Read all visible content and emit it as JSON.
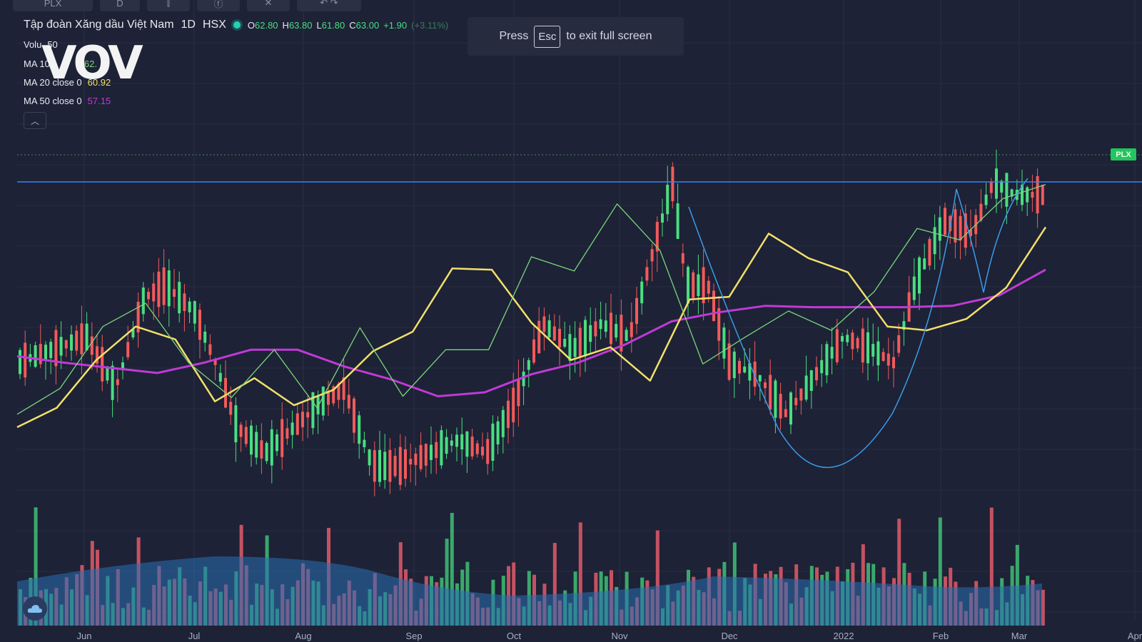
{
  "toolbar": {
    "symbol": "PLX",
    "interval_btn": "D"
  },
  "legend": {
    "name": "Tập đoàn Xăng dầu Việt Nam",
    "interval": "1D",
    "exchange": "HSX",
    "ohlc": {
      "o_key": "O",
      "o_val": "62.80",
      "h_key": "H",
      "h_val": "63.80",
      "l_key": "L",
      "l_val": "61.80",
      "c_key": "C",
      "c_val": "63.00",
      "change": "+1.90",
      "change_pct": "(+3.11%)"
    },
    "volume_label": "Volu",
    "volume_val": "50",
    "ma10_label": "MA 10",
    "ma10_val": "62.",
    "ma20_label": "MA 20 close 0",
    "ma20_val": "60.92",
    "ma50_label": "MA 50 close 0",
    "ma50_val": "57.15"
  },
  "fullscreen": {
    "press": "Press",
    "key": "Esc",
    "rest": "to exit full screen"
  },
  "watermark": "VOV",
  "price_tag": "PLX",
  "colors": {
    "background": "#1d2236",
    "up": "#4ade80",
    "down": "#f25a5a",
    "ma10": "#7bd67b",
    "ma20": "#f2e06a",
    "ma50": "#c03ad6",
    "ma_blue": "#3b9be8",
    "hline": "#3b82f6",
    "volume_area": "#2a6fb5"
  },
  "chart_data": {
    "type": "line",
    "x_labels": [
      "Jun",
      "Jul",
      "Aug",
      "Sep",
      "Oct",
      "Nov",
      "Dec",
      "2022",
      "Feb",
      "Mar",
      "Apr"
    ],
    "series": [
      {
        "name": "MA 20 close 0",
        "values": [
          45.0,
          46.5,
          50.2,
          52.8,
          51.8,
          47.0,
          48.8,
          46.7,
          47.9,
          50.9,
          52.4,
          57.3,
          57.2,
          53.1,
          50.2,
          51.2,
          48.6,
          54.9,
          55.1,
          60.0,
          58.1,
          57.0,
          52.8,
          52.5,
          53.4,
          55.8,
          60.5
        ]
      },
      {
        "name": "MA 50 close 0",
        "values": [
          50.5,
          50.0,
          49.6,
          49.2,
          50.0,
          51.0,
          51.0,
          49.7,
          48.7,
          47.4,
          47.7,
          49.1,
          50.0,
          51.4,
          53.2,
          53.9,
          54.4,
          54.3,
          54.3,
          54.3,
          54.4,
          55.2,
          57.2
        ]
      },
      {
        "name": "MA 10",
        "values": [
          46.0,
          48.0,
          52.8,
          54.6,
          50.0,
          47.3,
          51.0,
          46.5,
          52.7,
          47.4,
          51.0,
          51.0,
          58.2,
          57.1,
          62.3,
          58.7,
          49.9,
          52.0,
          54.0,
          52.5,
          55.5,
          60.4,
          59.5,
          62.7,
          63.8
        ]
      }
    ],
    "y_reference_line": 64.0,
    "last_price": 63.0
  }
}
